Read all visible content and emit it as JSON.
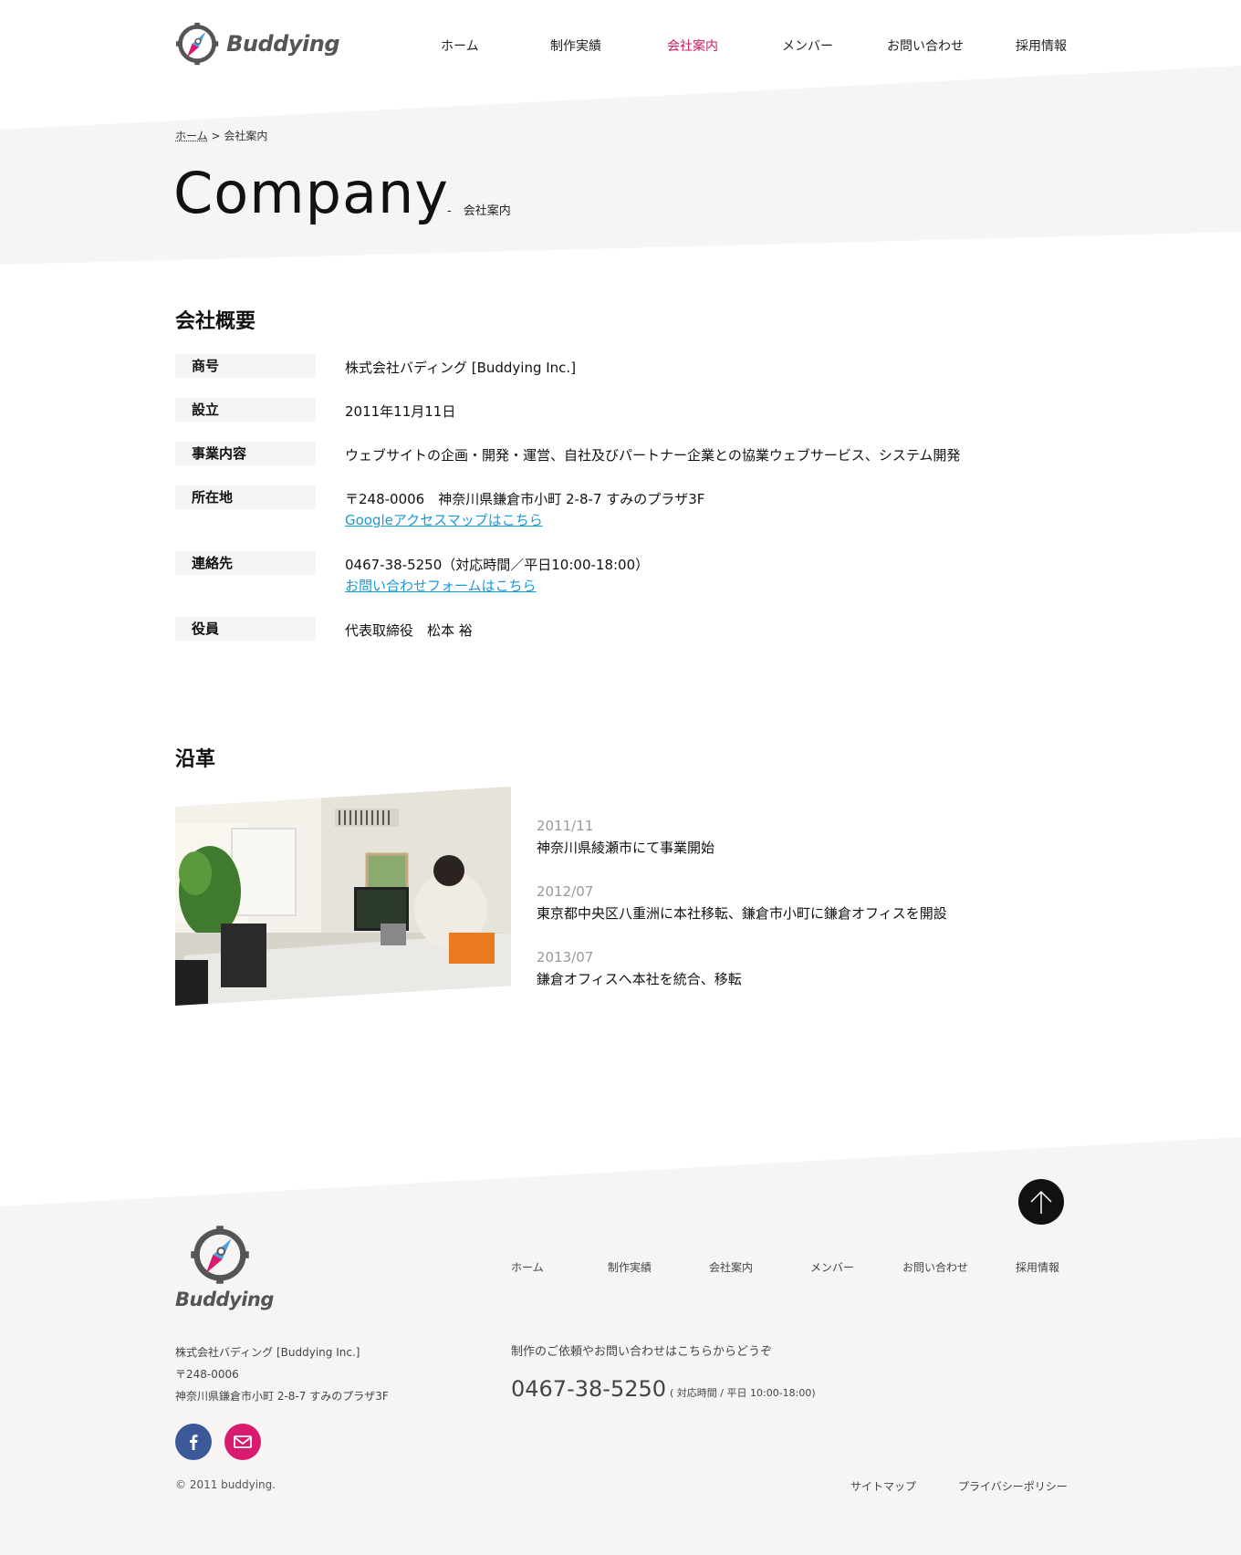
{
  "header": {
    "logo_text": "Buddying",
    "nav": [
      {
        "label": "ホーム"
      },
      {
        "label": "制作実績"
      },
      {
        "label": "会社案内"
      },
      {
        "label": "メンバー"
      },
      {
        "label": "お問い合わせ"
      },
      {
        "label": "採用情報"
      }
    ],
    "active_nav": "会社案内"
  },
  "breadcrumb": {
    "home": "ホーム",
    "separator": ">",
    "current": "会社案内"
  },
  "page": {
    "title": "Company",
    "subtitle": "-　会社案内"
  },
  "overview": {
    "heading": "会社概要",
    "rows": [
      {
        "label": "商号",
        "value": "株式会社バディング [Buddying Inc.]"
      },
      {
        "label": "設立",
        "value": "2011年11月11日"
      },
      {
        "label": "事業内容",
        "value": "ウェブサイトの企画・開発・運営、自社及びパートナー企業との協業ウェブサービス、システム開発"
      },
      {
        "label": "所在地",
        "value": "〒248-0006　神奈川県鎌倉市小町 2-8-7 すみのプラザ3F",
        "link": "Googleアクセスマップはこちら"
      },
      {
        "label": "連絡先",
        "value": "0467-38-5250（対応時間／平日10:00-18:00）",
        "link": "お問い合わせフォームはこちら"
      },
      {
        "label": "役員",
        "value": "代表取締役　松本 裕"
      }
    ]
  },
  "history": {
    "heading": "沿革",
    "items": [
      {
        "date": "2011/11",
        "text": "神奈川県綾瀬市にて事業開始"
      },
      {
        "date": "2012/07",
        "text": "東京都中央区八重洲に本社移転、鎌倉市小町に鎌倉オフィスを開設"
      },
      {
        "date": "2013/07",
        "text": "鎌倉オフィスへ本社を統合、移転"
      }
    ]
  },
  "footer": {
    "logo_text": "Buddying",
    "nav": [
      {
        "label": "ホーム"
      },
      {
        "label": "制作実績"
      },
      {
        "label": "会社案内"
      },
      {
        "label": "メンバー"
      },
      {
        "label": "お問い合わせ"
      },
      {
        "label": "採用情報"
      }
    ],
    "company_lines": [
      "株式会社バディング [Buddying Inc.]",
      "〒248-0006",
      "神奈川県鎌倉市小町 2-8-7 すみのプラザ3F"
    ],
    "contact_lead": "制作のご依頼やお問い合わせはこちらからどうぞ",
    "phone": "0467-38-5250",
    "hours": "( 対応時間 / 平日 10:00-18:00)",
    "copyright": "© 2011 buddying.",
    "links": {
      "sitemap": "サイトマップ",
      "privacy": "プライバシーポリシー"
    }
  },
  "icons": {
    "logo": "compass-rocket-icon",
    "to_top": "arrow-up-icon",
    "facebook": "facebook-icon",
    "mail": "mail-icon"
  },
  "colors": {
    "accent": "#cc1a5f",
    "link": "#1a9ad6",
    "band": "#f7f5f4",
    "facebook": "#3b5998",
    "mail": "#d81b6e"
  }
}
